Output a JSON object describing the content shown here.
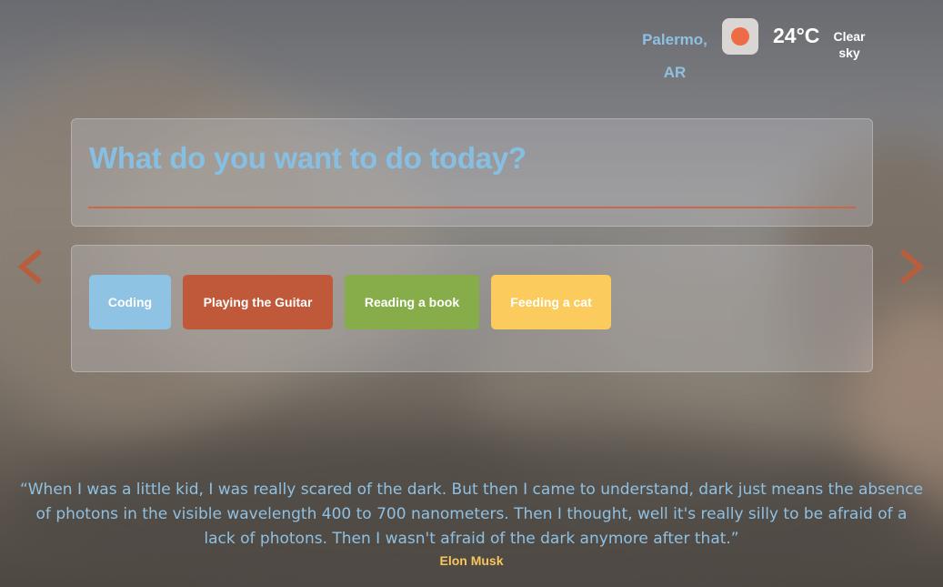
{
  "weather": {
    "city": "Palermo,",
    "country": "AR",
    "icon": "sun-icon",
    "temperature": "24°C",
    "condition_line1": "Clear",
    "condition_line2": "sky"
  },
  "prompt": {
    "question": "What do you want to do today?"
  },
  "tasks": [
    {
      "label": "Coding",
      "color": "#8ec3e3"
    },
    {
      "label": "Playing the Guitar",
      "color": "#c0583a"
    },
    {
      "label": "Reading a book",
      "color": "#86ad49"
    },
    {
      "label": "Feeding a cat",
      "color": "#fbcc5d"
    }
  ],
  "nav": {
    "prev_icon": "chevron-left-icon",
    "next_icon": "chevron-right-icon",
    "accent": "#b75e3e"
  },
  "quote": {
    "text": "“When I was a little kid, I was really scared of the dark. But then I came to understand, dark just means the absence of photons in the visible wavelength 400 to 700 nanometers. Then I thought, well it's really silly to be afraid of a lack of photons. Then I wasn't afraid of the dark anymore after that.”",
    "author": "Elon Musk"
  }
}
